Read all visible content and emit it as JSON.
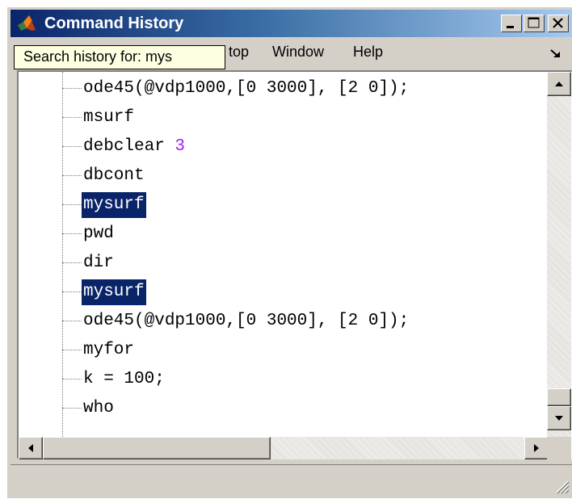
{
  "window": {
    "title": "Command History",
    "minimize_icon": "minimize-icon",
    "maximize_icon": "maximize-icon",
    "close_icon": "close-icon",
    "app_icon": "matlab-icon"
  },
  "menu": {
    "items": [
      "top",
      "Window",
      "Help"
    ],
    "undock_icon": "undock-arrow-icon"
  },
  "tooltip": {
    "text": "Search history for: mys"
  },
  "history": {
    "entries": [
      {
        "pre": "ode45(@vdp1000,[0 3000], [2 0]);",
        "num": "",
        "selected": false
      },
      {
        "pre": "msurf",
        "num": "",
        "selected": false
      },
      {
        "pre": "debclear ",
        "num": "3",
        "selected": false
      },
      {
        "pre": "dbcont",
        "num": "",
        "selected": false
      },
      {
        "pre": "mysurf",
        "num": "",
        "selected": true
      },
      {
        "pre": "pwd",
        "num": "",
        "selected": false
      },
      {
        "pre": "dir",
        "num": "",
        "selected": false
      },
      {
        "pre": "mysurf",
        "num": "",
        "selected": true
      },
      {
        "pre": "ode45(@vdp1000,[0 3000], [2 0]);",
        "num": "",
        "selected": false
      },
      {
        "pre": "myfor",
        "num": "",
        "selected": false
      },
      {
        "pre": "k = 100;",
        "num": "",
        "selected": false
      },
      {
        "pre": "who",
        "num": "",
        "selected": false
      }
    ]
  },
  "colors": {
    "selection": "#0a246a",
    "number": "#a020f0",
    "tooltip_bg": "#ffffe1",
    "chrome": "#d4d0c8"
  }
}
